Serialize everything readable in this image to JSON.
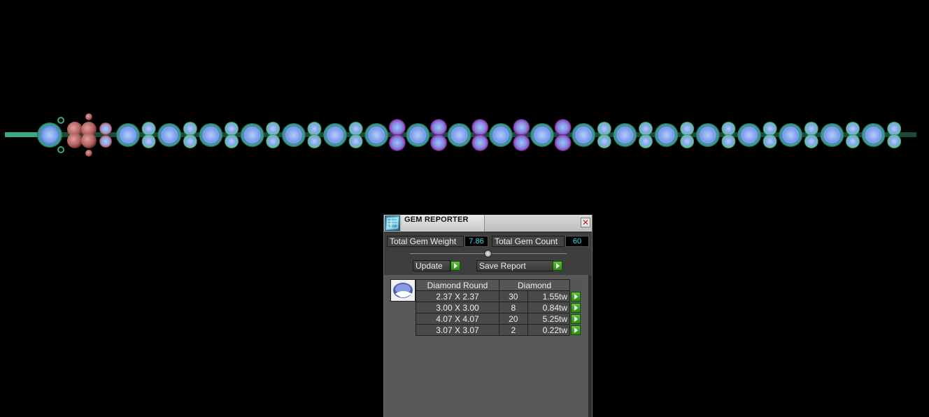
{
  "panel": {
    "title": "GEM REPORTER",
    "close_glyph": "✕",
    "total_weight_label": "Total Gem Weight",
    "total_weight_value": "7.86",
    "total_count_label": "Total Gem Count",
    "total_count_value": "60",
    "update_label": "Update",
    "save_label": "Save Report",
    "table": {
      "col_shape": "Diamond Round",
      "col_material": "Diamond",
      "rows": [
        {
          "size": "2.37 X 2.37",
          "count": "30",
          "weight": "1.55tw"
        },
        {
          "size": "3.00 X 3.00",
          "count": "8",
          "weight": "0.84tw"
        },
        {
          "size": "4.07 X 4.07",
          "count": "20",
          "weight": "5.25tw"
        },
        {
          "size": "3.07 X 3.07",
          "count": "2",
          "weight": "0.22tw"
        }
      ]
    }
  },
  "colors": {
    "viewport_bg": "#000000",
    "bezel": "#3aa882",
    "diamond": "#8fb4ff",
    "accent_purple": "#9a4cc0",
    "clasp": "#c8706a",
    "value_text": "#3fe0e8",
    "go_green": "#3fa61d"
  },
  "icons": {
    "app": "gem-reporter-app-icon",
    "close": "close-icon",
    "go": "play-arrow-icon",
    "thumb": "diamond-round-thumbnail"
  }
}
